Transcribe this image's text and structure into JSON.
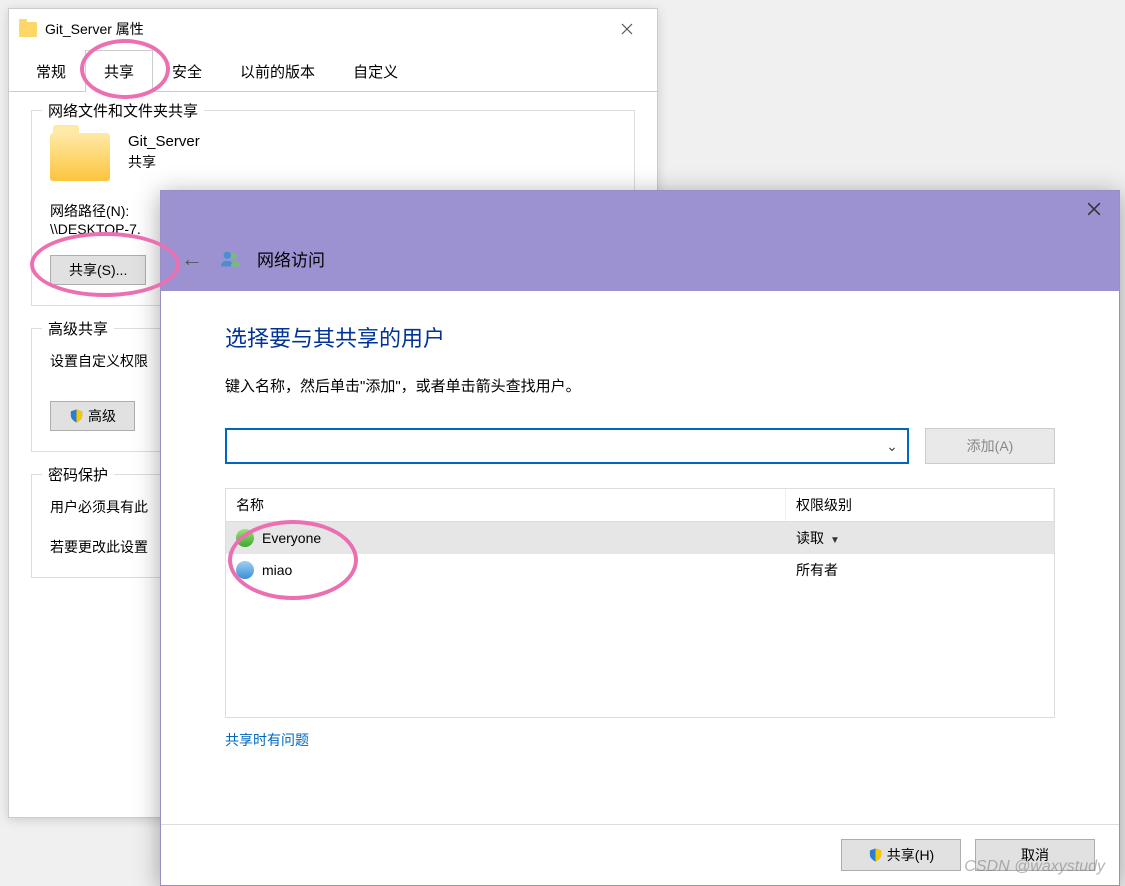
{
  "props": {
    "title": "Git_Server 属性",
    "tabs": [
      "常规",
      "共享",
      "安全",
      "以前的版本",
      "自定义"
    ],
    "activeTab": 1,
    "share_group_legend": "网络文件和文件夹共享",
    "folder_name": "Git_Server",
    "share_status": "共享",
    "net_path_label": "网络路径(N):",
    "net_path_value": "\\\\DESKTOP-7.",
    "share_btn": "共享(S)...",
    "adv_group_legend": "高级共享",
    "adv_desc": "设置自定义权限",
    "adv_btn": "高级",
    "pwd_group_legend": "密码保护",
    "pwd_line1": "用户必须具有此",
    "pwd_line2": "若要更改此设置"
  },
  "sharewin": {
    "nav_title": "网络访问",
    "heading": "选择要与其共享的用户",
    "hint": "键入名称，然后单击\"添加\"，或者单击箭头查找用户。",
    "add_btn": "添加(A)",
    "col_name": "名称",
    "col_perm": "权限级别",
    "rows": [
      {
        "name": "Everyone",
        "perm": "读取",
        "style": "user-green",
        "selected": true
      },
      {
        "name": "miao",
        "perm": "所有者",
        "style": "user-blue",
        "selected": false
      }
    ],
    "trouble": "共享时有问题",
    "footer_share": "共享(H)",
    "footer_cancel": "取消"
  },
  "watermark": "CSDN @waxystudy"
}
